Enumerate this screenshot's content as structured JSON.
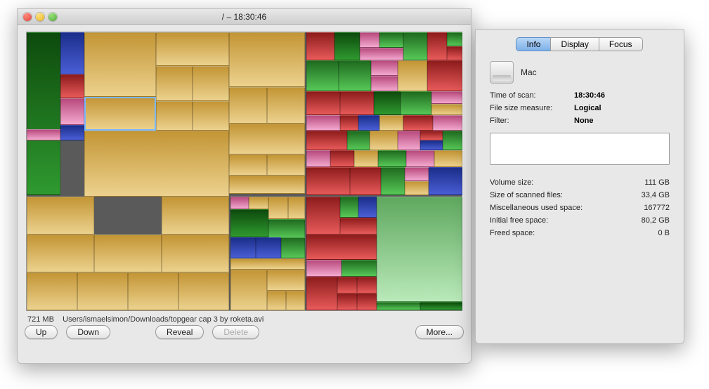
{
  "window": {
    "title": "/ – 18:30:46"
  },
  "status": {
    "file_size": "721 MB",
    "file_path": "Users/ismaelsimon/Downloads/topgear cap 3 by roketa.avi"
  },
  "buttons": {
    "up": "Up",
    "down": "Down",
    "reveal": "Reveal",
    "delete": "Delete",
    "more": "More..."
  },
  "info": {
    "tabs": {
      "info": "Info",
      "display": "Display",
      "focus": "Focus"
    },
    "drive_name": "Mac",
    "rows1": {
      "time_of_scan": {
        "label": "Time of scan:",
        "value": "18:30:46"
      },
      "file_size_measure": {
        "label": "File size measure:",
        "value": "Logical"
      },
      "filter": {
        "label": "Filter:",
        "value": "None"
      }
    },
    "rows2": {
      "volume_size": {
        "label": "Volume size:",
        "value": "111 GB"
      },
      "scanned_files": {
        "label": "Size of scanned files:",
        "value": "33,4 GB"
      },
      "misc_used": {
        "label": "Miscellaneous used space:",
        "value": "167772"
      },
      "initial_free": {
        "label": "Initial free space:",
        "value": "80,2 GB"
      },
      "freed": {
        "label": "Freed space:",
        "value": "0 B"
      }
    }
  },
  "treemap": {
    "selected_file": "topgear cap 3 by roketa.avi",
    "colors": {
      "tan": "#ecd28e",
      "pink": "#f3a9cf",
      "red": "#e85a5a",
      "green": "#57c857",
      "blue": "#4a5ed6"
    }
  }
}
